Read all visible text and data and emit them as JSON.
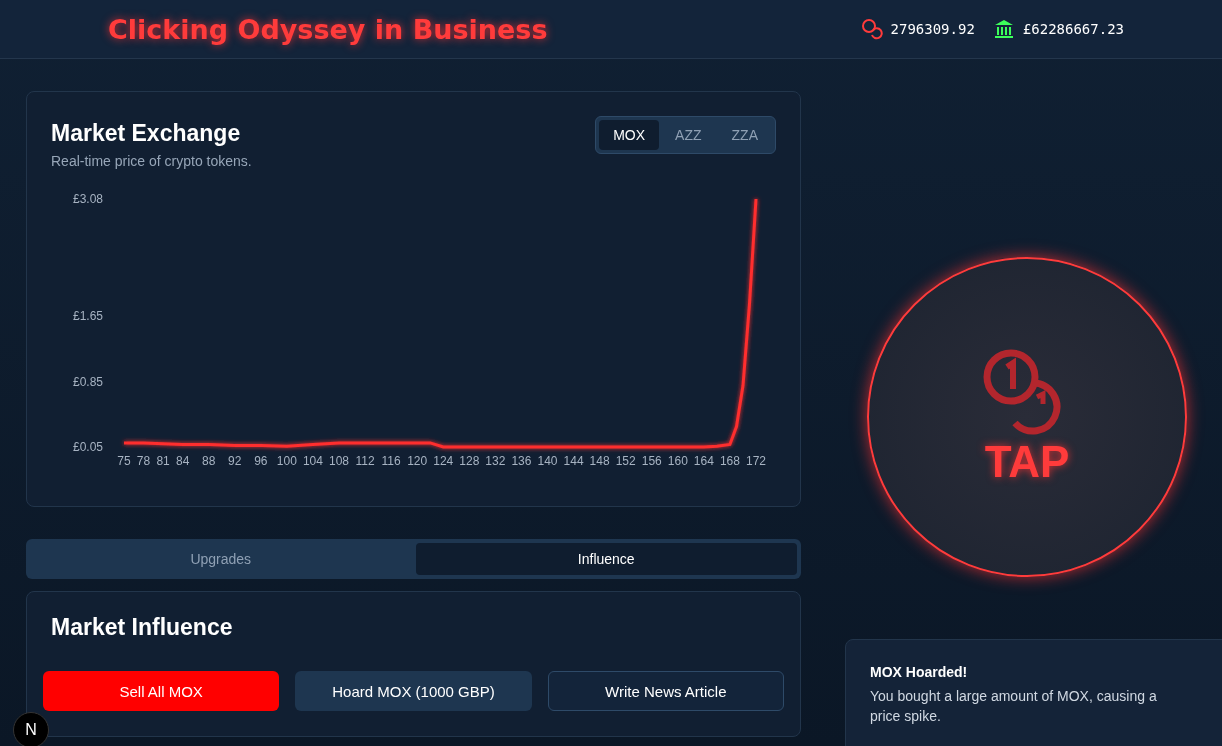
{
  "header": {
    "title": "Clicking Odyssey in Business",
    "tokens": "2796309.92",
    "bank": "£62286667.23"
  },
  "market": {
    "title": "Market Exchange",
    "subtitle": "Real-time price of crypto tokens.",
    "tokens": [
      {
        "label": "MOX",
        "selected": true
      },
      {
        "label": "AZZ",
        "selected": false
      },
      {
        "label": "ZZA",
        "selected": false
      }
    ],
    "chart_data": {
      "type": "line",
      "x": [
        75,
        78,
        81,
        84,
        88,
        92,
        96,
        100,
        104,
        108,
        112,
        116,
        120,
        122,
        124,
        128,
        132,
        136,
        140,
        144,
        148,
        152,
        156,
        160,
        164,
        166,
        168,
        169,
        170,
        171,
        172
      ],
      "series": [
        {
          "color": "#ff2d2d",
          "values": [
            0.1,
            0.1,
            0.09,
            0.08,
            0.08,
            0.07,
            0.07,
            0.06,
            0.08,
            0.1,
            0.1,
            0.1,
            0.1,
            0.1,
            0.05,
            0.05,
            0.05,
            0.05,
            0.05,
            0.05,
            0.05,
            0.05,
            0.05,
            0.05,
            0.05,
            0.06,
            0.08,
            0.3,
            0.8,
            1.8,
            3.08
          ]
        }
      ],
      "xlim": [
        75,
        172
      ],
      "ylim": [
        0.05,
        3.08
      ],
      "yticks": [
        {
          "value": 0.05,
          "label": "£0.05"
        },
        {
          "value": 0.85,
          "label": "£0.85"
        },
        {
          "value": 1.65,
          "label": "£1.65"
        },
        {
          "value": 3.08,
          "label": "£3.08"
        }
      ],
      "xticks": [
        75,
        78,
        81,
        84,
        88,
        92,
        96,
        100,
        104,
        108,
        112,
        116,
        120,
        124,
        128,
        132,
        136,
        140,
        144,
        148,
        152,
        156,
        160,
        164,
        168,
        172
      ]
    }
  },
  "tabs": [
    {
      "label": "Upgrades",
      "selected": false
    },
    {
      "label": "Influence",
      "selected": true
    }
  ],
  "influence": {
    "title": "Market Influence",
    "actions": [
      {
        "label": "Sell All MOX",
        "kind": "danger"
      },
      {
        "label": "Hoard MOX (1000 GBP)",
        "kind": "primary"
      },
      {
        "label": "Write News Article",
        "kind": "outline"
      }
    ]
  },
  "tap": {
    "label": "TAP"
  },
  "toast": {
    "title": "MOX Hoarded!",
    "message": "You bought a large amount of MOX, causing a price spike."
  },
  "dev_badge": "N"
}
